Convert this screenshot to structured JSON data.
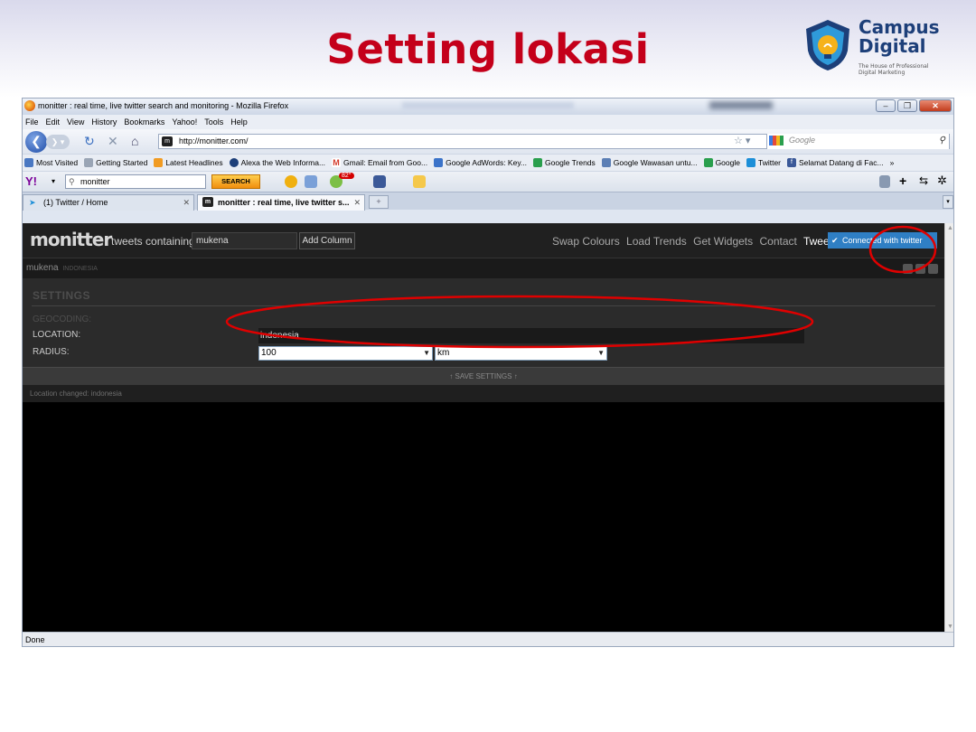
{
  "slide": {
    "title": "Setting lokasi",
    "logo": {
      "line1": "Campus",
      "line2": "Digital",
      "tagline": "The House of Professional Digital Marketing"
    }
  },
  "browser": {
    "window_title": "monitter : real time, live twitter search and monitoring - Mozilla Firefox",
    "menu": [
      "File",
      "Edit",
      "View",
      "History",
      "Bookmarks",
      "Yahoo!",
      "Tools",
      "Help"
    ],
    "url": "http://monitter.com/",
    "search_engine": "Google",
    "bookmarks": [
      {
        "label": "Most Visited",
        "color": "#4a78c2"
      },
      {
        "label": "Getting Started",
        "color": "#9aa5b5"
      },
      {
        "label": "Latest Headlines",
        "color": "#f19b22"
      },
      {
        "label": "Alexa the Web Informa...",
        "color": "#1d3f79"
      },
      {
        "label": "Gmail: Email from Goo...",
        "color": "#d43a2a"
      },
      {
        "label": "Google AdWords: Key...",
        "color": "#3b73c9"
      },
      {
        "label": "Google Trends",
        "color": "#2a9f4d"
      },
      {
        "label": "Google Wawasan untu...",
        "color": "#5c7fb5"
      },
      {
        "label": "Google",
        "color": "#2a9f4d"
      },
      {
        "label": "Twitter",
        "color": "#1d8fd8"
      },
      {
        "label": "Selamat Datang di Fac...",
        "color": "#3b5998"
      }
    ],
    "bookmarks_more": "»",
    "yahoo_label": "Y!",
    "yahoo_search_value": "monitter",
    "search_button": "SEARCH",
    "weather_badge": "82°",
    "tabs": [
      {
        "label": "(1) Twitter / Home",
        "active": false
      },
      {
        "label": "monitter : real time, live twitter s...",
        "active": true
      }
    ],
    "status": "Done"
  },
  "monitter": {
    "logo": "monitter",
    "tweets_containing_label": "tweets containing",
    "query": "mukena",
    "add_column": "Add Column",
    "nav": [
      "Swap Colours",
      "Load Trends",
      "Get Widgets",
      "Contact"
    ],
    "tweet_link": "Tweet",
    "connect": "Connected with twitter",
    "column_name": "mukena",
    "column_location": "INDONESIA",
    "settings_title": "SETTINGS",
    "geocoding_label": "GEOCODING:",
    "location_label": "LOCATION:",
    "location_value": "indonesia",
    "radius_label": "RADIUS:",
    "radius_value": "100",
    "radius_unit": "km",
    "save_settings": "↑ SAVE SETTINGS ↑",
    "status_message": "Location changed: indonesia"
  },
  "colors": {
    "title_red": "#c4001a",
    "brand_blue": "#1d3f79",
    "annotation_red": "#e00000",
    "connect_blue": "#2f7fc4"
  }
}
